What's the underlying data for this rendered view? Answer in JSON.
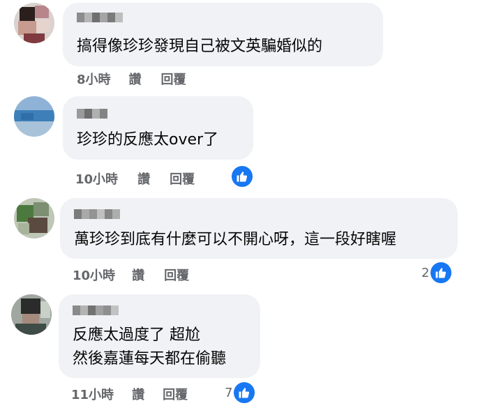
{
  "colors": {
    "bubble": "#f0f2f5",
    "meta_text": "#65676b",
    "like_blue": "#1877f2"
  },
  "comments": [
    {
      "text_lines": [
        "搞得像珍珍發現自己被文英騙婚似的"
      ],
      "time": "8小時",
      "like_action": "讚",
      "reply_action": "回覆",
      "reaction_count": null
    },
    {
      "text_lines": [
        "珍珍的反應太over了"
      ],
      "time": "10小時",
      "like_action": "讚",
      "reply_action": "回覆",
      "reaction_count": ""
    },
    {
      "text_lines": [
        "萬珍珍到底有什麼可以不開心呀，這一段好瞎喔"
      ],
      "time": "10小時",
      "like_action": "讚",
      "reply_action": "回覆",
      "reaction_count": "2"
    },
    {
      "text_lines": [
        "反應太過度了 超尬",
        "然後嘉蓮每天都在偷聽"
      ],
      "time": "11小時",
      "like_action": "讚",
      "reply_action": "回覆",
      "reaction_count": "7"
    }
  ],
  "icons": {
    "like_badge": "thumbs-up-icon"
  }
}
